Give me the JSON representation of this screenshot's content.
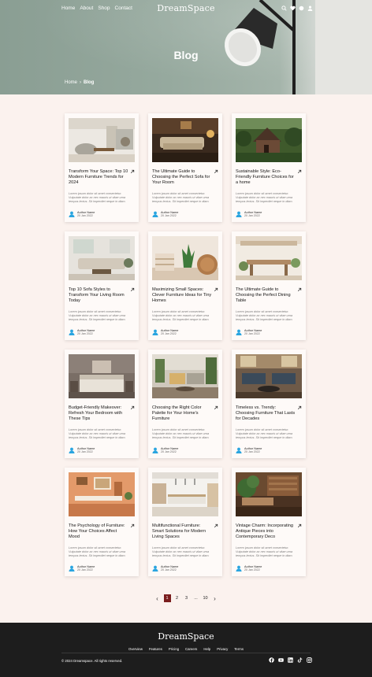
{
  "brand": "DreamSpace",
  "nav": {
    "links": [
      "Home",
      "About",
      "Shop",
      "Contact"
    ]
  },
  "hero": {
    "title": "Blog",
    "breadcrumb": {
      "home": "Home",
      "separator": "›",
      "current": "Blog"
    }
  },
  "posts": [
    {
      "title": "Transform Your Space: Top 10 Modern Furniture Trends for 2024",
      "excerpt": "Lorem ipsum dolor sit amet consectetur. Vulputate dolor ac nec mauris ut vitae urna tempus lectus. Sit imperdiet neque in diam.",
      "author": "Author Name",
      "date": "20 Jan 2022"
    },
    {
      "title": "The Ultimate Guide to Choosing the Perfect Sofa for Your Room",
      "excerpt": "Lorem ipsum dolor sit amet consectetur. Vulputate dolor ac nec mauris ut vitae urna tempus lectus. Sit imperdiet neque in diam.",
      "author": "Author Name",
      "date": "20 Jan 2022"
    },
    {
      "title": "Sustainable Style: Eco-Friendly Furniture Choices for a home",
      "excerpt": "Lorem ipsum dolor sit amet consectetur. Vulputate dolor ac nec mauris ut vitae urna tempus lectus. Sit imperdiet neque in diam.",
      "author": "Author Name",
      "date": "20 Jan 2022"
    },
    {
      "title": "Top 10 Sofa Styles to Transform Your Living Room Today",
      "excerpt": "Lorem ipsum dolor sit amet consectetur. Vulputate dolor ac nec mauris ut vitae urna tempus lectus. Sit imperdiet neque in diam.",
      "author": "Author Name",
      "date": "20 Jan 2022"
    },
    {
      "title": "Maximizing Small Spaces: Clever Furniture Ideas for Tiny Homes",
      "excerpt": "Lorem ipsum dolor sit amet consectetur. Vulputate dolor ac nec mauris ut vitae urna tempus lectus. Sit imperdiet neque in diam.",
      "author": "Author Name",
      "date": "20 Jan 2022"
    },
    {
      "title": "The Ultimate Guide to Choosing the Perfect Dining Table",
      "excerpt": "Lorem ipsum dolor sit amet consectetur. Vulputate dolor ac nec mauris ut vitae urna tempus lectus. Sit imperdiet neque in diam.",
      "author": "Author Name",
      "date": "20 Jan 2022"
    },
    {
      "title": "Budget-Friendly Makeover: Refresh Your Bedroom with These Tips",
      "excerpt": "Lorem ipsum dolor sit amet consectetur. Vulputate dolor ac nec mauris ut vitae urna tempus lectus. Sit imperdiet neque in diam.",
      "author": "Author Name",
      "date": "20 Jan 2022"
    },
    {
      "title": "Choosing the Right Color Palette for Your Home's Furniture",
      "excerpt": "Lorem ipsum dolor sit amet consectetur. Vulputate dolor ac nec mauris ut vitae urna tempus lectus. Sit imperdiet neque in diam.",
      "author": "Author Name",
      "date": "20 Jan 2022"
    },
    {
      "title": "Timeless vs. Trendy: Choosing Furniture That Lasts for Decades",
      "excerpt": "Lorem ipsum dolor sit amet consectetur. Vulputate dolor ac nec mauris ut vitae urna tempus lectus. Sit imperdiet neque in diam.",
      "author": "Author Name",
      "date": "20 Jan 2022"
    },
    {
      "title": "The Psychology of Furniture: How Your Choices Affect Mood",
      "excerpt": "Lorem ipsum dolor sit amet consectetur. Vulputate dolor ac nec mauris ut vitae urna tempus lectus. Sit imperdiet neque in diam.",
      "author": "Author Name",
      "date": "20 Jan 2022"
    },
    {
      "title": "Multifunctional Furniture: Smart Solutions for Modern Living Spaces",
      "excerpt": "Lorem ipsum dolor sit amet consectetur. Vulputate dolor ac nec mauris ut vitae urna tempus lectus. Sit imperdiet neque in diam.",
      "author": "Author Name",
      "date": "20 Jan 2022"
    },
    {
      "title": "Vintage Charm: Incorporating Antique Pieces into Contemporary Deco",
      "excerpt": "Lorem ipsum dolor sit amet consectetur. Vulputate dolor ac nec mauris ut vitae urna tempus lectus. Sit imperdiet neque in diam.",
      "author": "Author Name",
      "date": "20 Jan 2022"
    }
  ],
  "pagination": {
    "pages": [
      "1",
      "2",
      "3",
      "...",
      "10"
    ],
    "current": "1"
  },
  "footer": {
    "brand": "DreamSpace",
    "links": [
      "Overview",
      "Features",
      "Pricing",
      "Careers",
      "Help",
      "Privacy",
      "Terms"
    ],
    "copyright": "© 2024 Dreamspace. All rights reserved.",
    "social_icons": [
      "facebook-icon",
      "youtube-icon",
      "linkedin-icon",
      "tiktok-icon",
      "instagram-icon"
    ]
  },
  "colors": {
    "accent": "#7a1d1d",
    "background": "#fbf2ee",
    "footer": "#1d1d1d"
  }
}
